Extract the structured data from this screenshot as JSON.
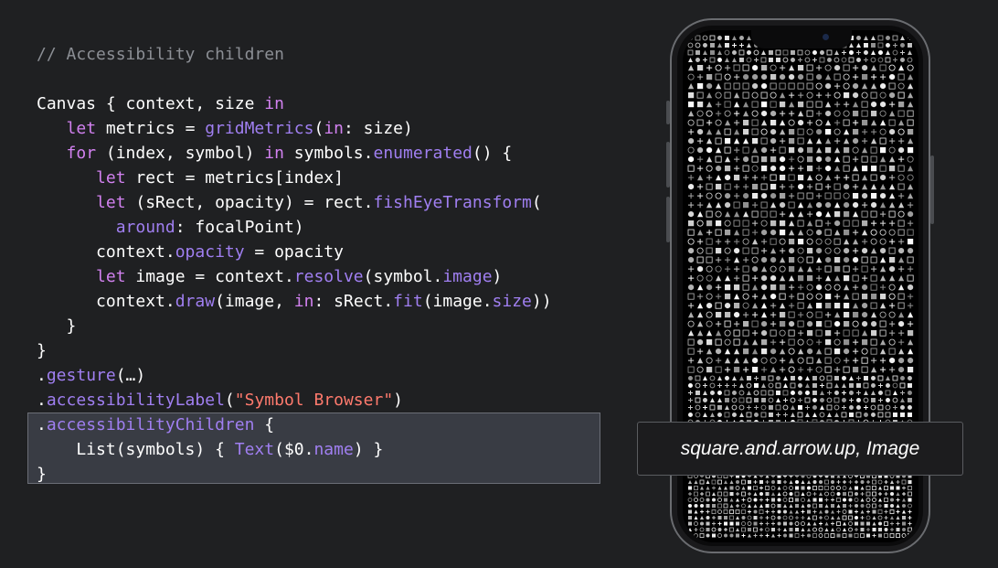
{
  "code": {
    "comment": "// Accessibility children",
    "lines": [
      [
        {
          "t": "Canvas { context, size ",
          "c": "plain"
        },
        {
          "t": "in",
          "c": "kw"
        }
      ],
      [
        {
          "t": "   ",
          "c": "plain"
        },
        {
          "t": "let",
          "c": "kw"
        },
        {
          "t": " metrics = ",
          "c": "plain"
        },
        {
          "t": "gridMetrics",
          "c": "fn"
        },
        {
          "t": "(",
          "c": "plain"
        },
        {
          "t": "in",
          "c": "kw"
        },
        {
          "t": ": size)",
          "c": "plain"
        }
      ],
      [
        {
          "t": "   ",
          "c": "plain"
        },
        {
          "t": "for",
          "c": "kw"
        },
        {
          "t": " (index, symbol) ",
          "c": "plain"
        },
        {
          "t": "in",
          "c": "kw"
        },
        {
          "t": " symbols.",
          "c": "plain"
        },
        {
          "t": "enumerated",
          "c": "fn"
        },
        {
          "t": "() {",
          "c": "plain"
        }
      ],
      [
        {
          "t": "      ",
          "c": "plain"
        },
        {
          "t": "let",
          "c": "kw"
        },
        {
          "t": " rect = metrics[index]",
          "c": "plain"
        }
      ],
      [
        {
          "t": "      ",
          "c": "plain"
        },
        {
          "t": "let",
          "c": "kw"
        },
        {
          "t": " (sRect, opacity) = rect.",
          "c": "plain"
        },
        {
          "t": "fishEyeTransform",
          "c": "fn"
        },
        {
          "t": "(",
          "c": "plain"
        }
      ],
      [
        {
          "t": "        ",
          "c": "plain"
        },
        {
          "t": "around",
          "c": "fn"
        },
        {
          "t": ": focalPoint)",
          "c": "plain"
        }
      ],
      [
        {
          "t": "      context.",
          "c": "plain"
        },
        {
          "t": "opacity",
          "c": "fn"
        },
        {
          "t": " = opacity",
          "c": "plain"
        }
      ],
      [
        {
          "t": "      ",
          "c": "plain"
        },
        {
          "t": "let",
          "c": "kw"
        },
        {
          "t": " image = context.",
          "c": "plain"
        },
        {
          "t": "resolve",
          "c": "fn"
        },
        {
          "t": "(symbol.",
          "c": "plain"
        },
        {
          "t": "image",
          "c": "fn"
        },
        {
          "t": ")",
          "c": "plain"
        }
      ],
      [
        {
          "t": "      context.",
          "c": "plain"
        },
        {
          "t": "draw",
          "c": "fn"
        },
        {
          "t": "(image, ",
          "c": "plain"
        },
        {
          "t": "in",
          "c": "kw"
        },
        {
          "t": ": sRect.",
          "c": "plain"
        },
        {
          "t": "fit",
          "c": "fn"
        },
        {
          "t": "(image.",
          "c": "plain"
        },
        {
          "t": "size",
          "c": "fn"
        },
        {
          "t": "))",
          "c": "plain"
        }
      ],
      [
        {
          "t": "   }",
          "c": "plain"
        }
      ],
      [
        {
          "t": "}",
          "c": "plain"
        }
      ],
      [
        {
          "t": ".",
          "c": "plain"
        },
        {
          "t": "gesture",
          "c": "fn"
        },
        {
          "t": "(…)",
          "c": "plain"
        }
      ],
      [
        {
          "t": ".",
          "c": "plain"
        },
        {
          "t": "accessibilityLabel",
          "c": "fn"
        },
        {
          "t": "(",
          "c": "plain"
        },
        {
          "t": "\"Symbol Browser\"",
          "c": "str"
        },
        {
          "t": ")",
          "c": "plain"
        }
      ],
      [
        {
          "t": ".",
          "c": "plain"
        },
        {
          "t": "accessibilityChildren",
          "c": "fn"
        },
        {
          "t": " {",
          "c": "plain"
        }
      ],
      [
        {
          "t": "    List(symbols) { ",
          "c": "plain"
        },
        {
          "t": "Text",
          "c": "fn"
        },
        {
          "t": "($0.",
          "c": "plain"
        },
        {
          "t": "name",
          "c": "fn"
        },
        {
          "t": ") }",
          "c": "plain"
        }
      ],
      [
        {
          "t": "}",
          "c": "plain"
        }
      ]
    ]
  },
  "tooltip": {
    "label": "square.and.arrow.up, Image"
  },
  "colors": {
    "keyword": "#d281f0",
    "function": "#a07ff1",
    "string": "#ff7a6d",
    "comment": "#8c8f95",
    "highlight": "#393c44"
  }
}
